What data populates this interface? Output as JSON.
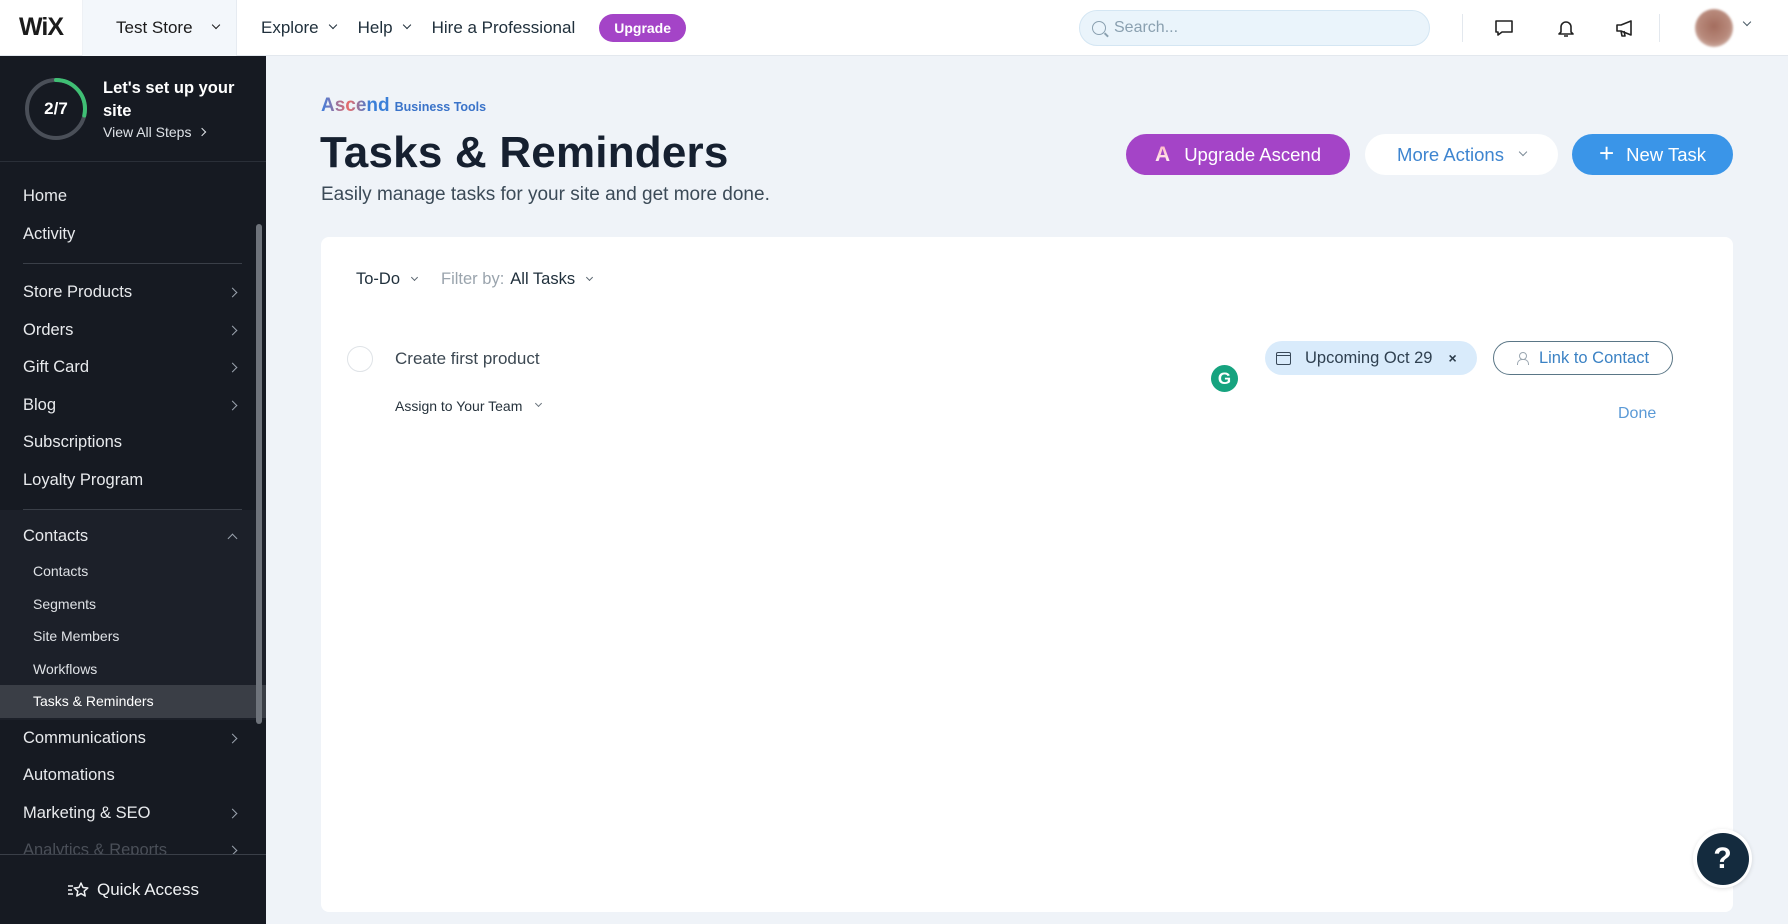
{
  "topbar": {
    "logo": "WiX",
    "site_name": "Test Store",
    "nav": [
      {
        "label": "Explore",
        "has_dropdown": true
      },
      {
        "label": "Help",
        "has_dropdown": true
      },
      {
        "label": "Hire a Professional",
        "has_dropdown": false
      }
    ],
    "upgrade_label": "Upgrade",
    "search_placeholder": "Search...",
    "icons": [
      "chat-icon",
      "bell-icon",
      "megaphone-icon"
    ],
    "brand_color": "#a444c7"
  },
  "sidebar": {
    "setup": {
      "progress_label": "2/7",
      "progress_fraction": 0.2857,
      "title": "Let's set up your site",
      "link": "View All Steps"
    },
    "items_top": [
      {
        "label": "Home"
      },
      {
        "label": "Activity"
      }
    ],
    "items_main": [
      {
        "label": "Store Products",
        "has_children": true
      },
      {
        "label": "Orders",
        "has_children": true
      },
      {
        "label": "Gift Card",
        "has_children": true
      },
      {
        "label": "Blog",
        "has_children": true
      },
      {
        "label": "Subscriptions",
        "has_children": false
      },
      {
        "label": "Loyalty Program",
        "has_children": false
      }
    ],
    "contacts_group": {
      "label": "Contacts",
      "expanded": true,
      "children": [
        {
          "label": "Contacts",
          "active": false
        },
        {
          "label": "Segments",
          "active": false
        },
        {
          "label": "Site Members",
          "active": false
        },
        {
          "label": "Workflows",
          "active": false
        },
        {
          "label": "Tasks & Reminders",
          "active": true
        }
      ]
    },
    "items_bottom": [
      {
        "label": "Communications",
        "has_children": true
      },
      {
        "label": "Automations",
        "has_children": false
      },
      {
        "label": "Marketing & SEO",
        "has_children": true
      },
      {
        "label": "Analytics & Reports",
        "has_children": true
      }
    ],
    "quick_access": "Quick Access"
  },
  "page": {
    "brand": {
      "name": "Ascend",
      "sub": "Business Tools"
    },
    "title": "Tasks & Reminders",
    "subtitle": "Easily manage tasks for your site and get more done.",
    "actions": {
      "upgrade": "Upgrade Ascend",
      "more": "More Actions",
      "new_task": "New Task"
    }
  },
  "tasks": {
    "status_filter": "To-Do",
    "filter_label": "Filter by:",
    "filter_value": "All Tasks",
    "items": [
      {
        "title": "Create first product",
        "assignee": "Assign to Your Team",
        "due_chip": "Upcoming Oct 29",
        "link_contact": "Link to Contact",
        "done_label": "Done",
        "completed": false
      }
    ]
  },
  "help": {
    "label": "?"
  },
  "grammarly": {
    "label": "G"
  }
}
